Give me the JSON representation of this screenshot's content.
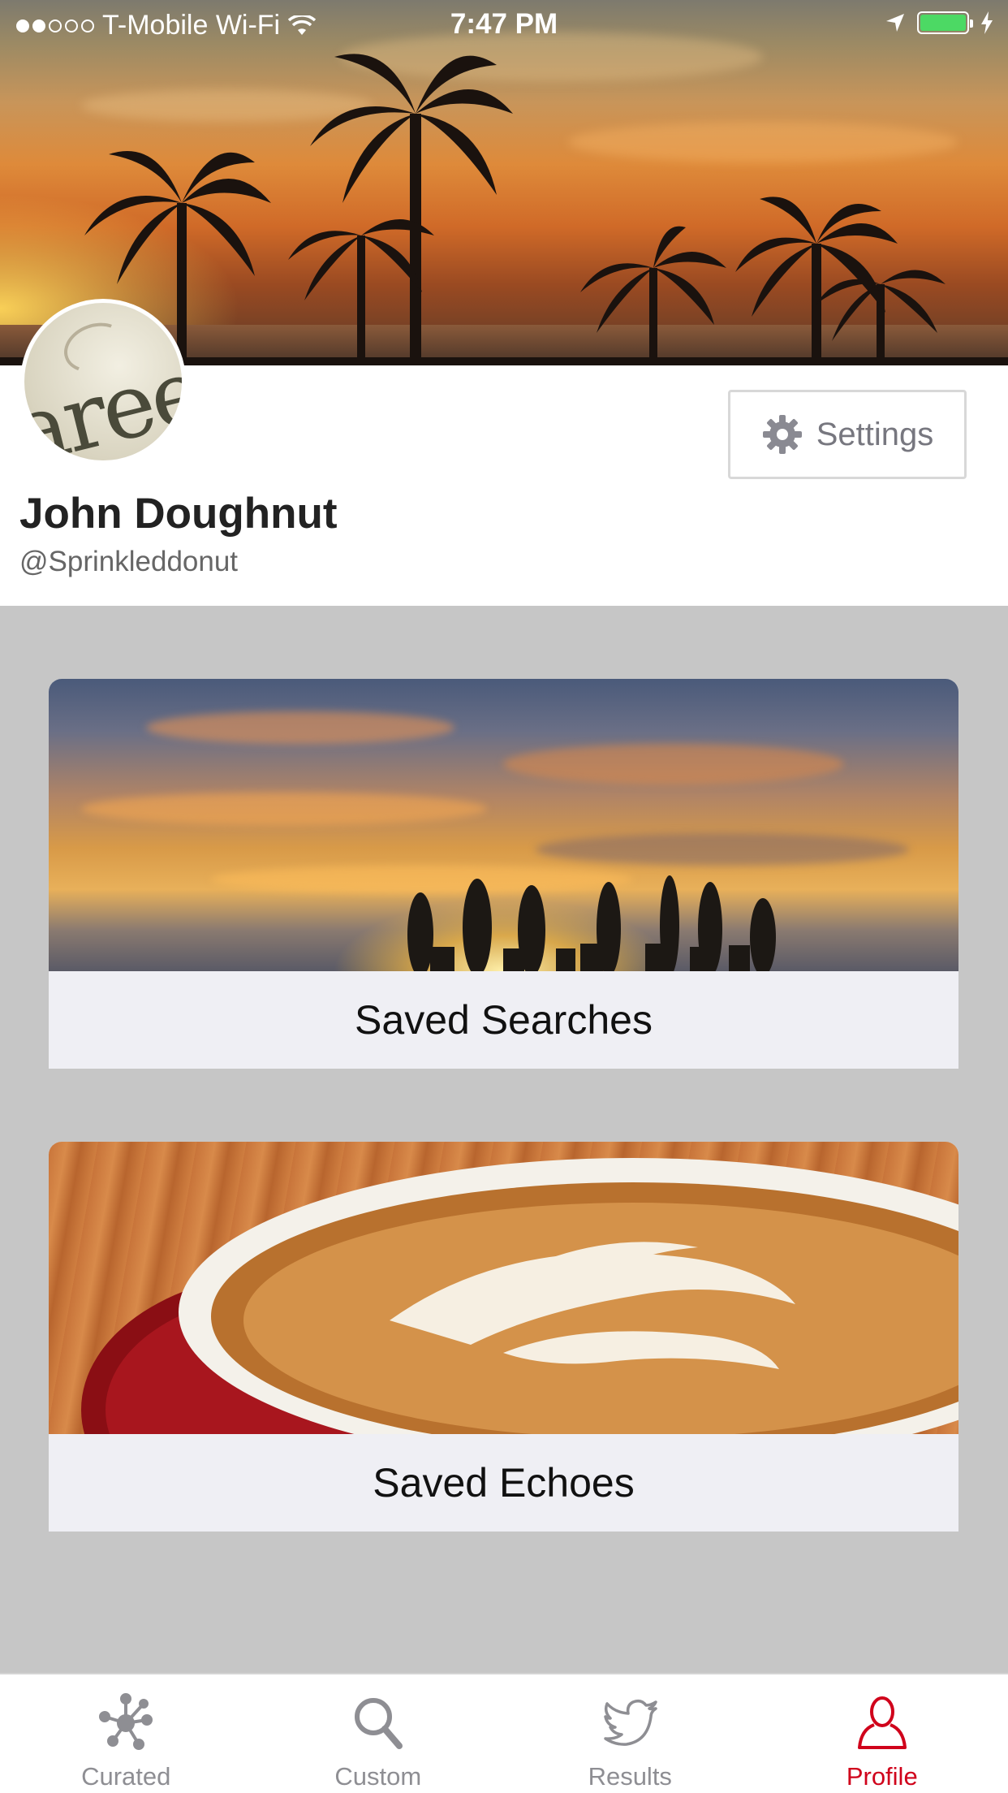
{
  "status_bar": {
    "carrier": "T-Mobile Wi-Fi",
    "time": "7:47 PM",
    "signal_dots_filled": 2,
    "signal_dots_total": 5,
    "battery_level": 1.0,
    "icons": [
      "wifi-icon",
      "location-arrow-icon",
      "battery-icon",
      "charging-bolt-icon"
    ]
  },
  "profile": {
    "name": "John Doughnut",
    "handle": "@Sprinkleddonut",
    "settings_label": "Settings"
  },
  "cards": [
    {
      "label": "Saved Searches",
      "image": "sunset-surfboards"
    },
    {
      "label": "Saved Echoes",
      "image": "latte-art-coffee"
    }
  ],
  "tabs": [
    {
      "label": "Curated",
      "icon": "network-nodes-icon",
      "active": false
    },
    {
      "label": "Custom",
      "icon": "search-icon",
      "active": false
    },
    {
      "label": "Results",
      "icon": "bird-icon",
      "active": false
    },
    {
      "label": "Profile",
      "icon": "person-icon",
      "active": true
    }
  ],
  "colors": {
    "accent": "#d0021b",
    "inactive_tab": "#8e8e93",
    "background": "#c6c6c6",
    "card_label_bg": "#efeff4",
    "battery": "#4cd964"
  }
}
